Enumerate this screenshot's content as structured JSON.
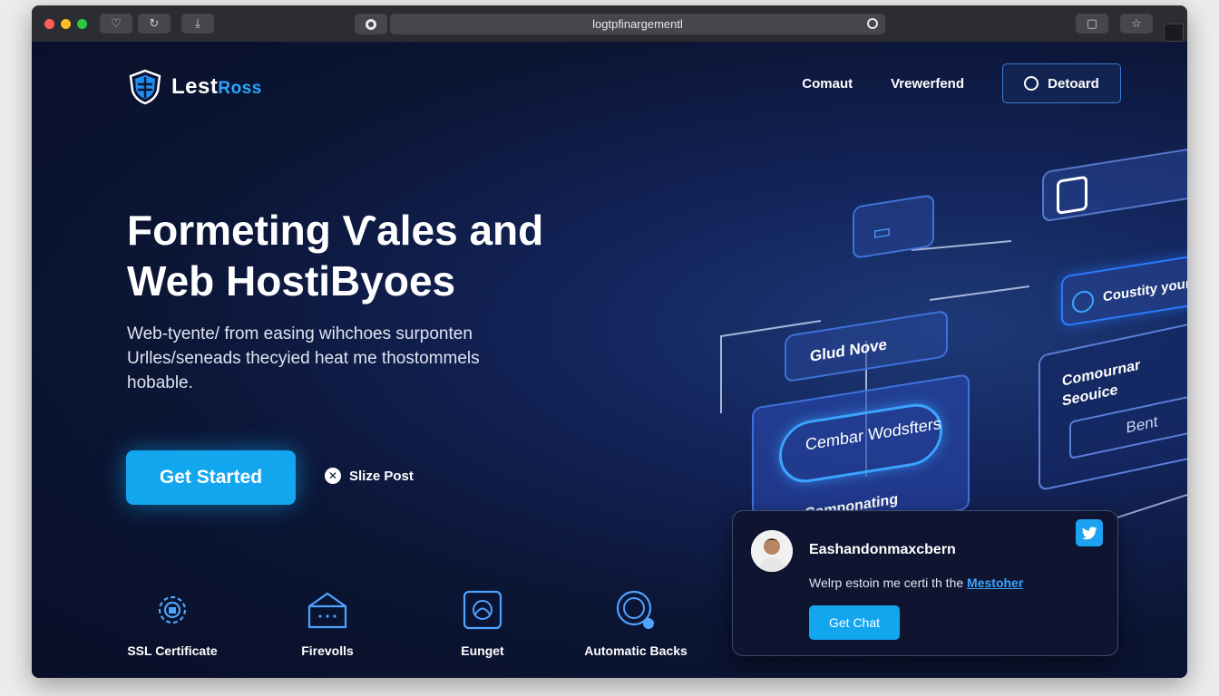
{
  "browser": {
    "url": "logtpfinargementl"
  },
  "brand": {
    "name": "Lest",
    "name_accent": "Ross"
  },
  "nav": {
    "link1": "Comaut",
    "link2": "Vrewerfend",
    "dashboard": "Detoard"
  },
  "hero": {
    "title_line1": "Formeting Ѵales and",
    "title_line2": "Web HostiByoes",
    "subtitle_line1": "Web-tyente/ from easing wihchoes surponten",
    "subtitle_line2": "Urlles/seneads thecyied heat me thostommels",
    "subtitle_line3": "hobable.",
    "cta": "Get Started",
    "secondary": "Slize Post"
  },
  "features": [
    {
      "label": "SSL Certificate",
      "icon": "ssl-gear-icon"
    },
    {
      "label": "Firevolls",
      "icon": "firewall-icon"
    },
    {
      "label": "Eunget",
      "icon": "budget-icon"
    },
    {
      "label": "Automatic Backs",
      "icon": "backup-icon"
    }
  ],
  "illustration": {
    "card_top_right": "Coustity youm Be",
    "card_cloud": "Glud Nove",
    "card_center": "Cembar Wodsfters",
    "card_right_title": "Comournar Seouice",
    "card_right_button": "Bent",
    "card_bottom": "Componating"
  },
  "chat": {
    "name": "Eashandonmaxcbern",
    "message": "Welrp estoin me certi th the ",
    "message_link": "Mestoher",
    "button": "Get Chat"
  },
  "colors": {
    "accent": "#12a6ef",
    "background": "#0b1534",
    "link": "#3aa4ff"
  }
}
